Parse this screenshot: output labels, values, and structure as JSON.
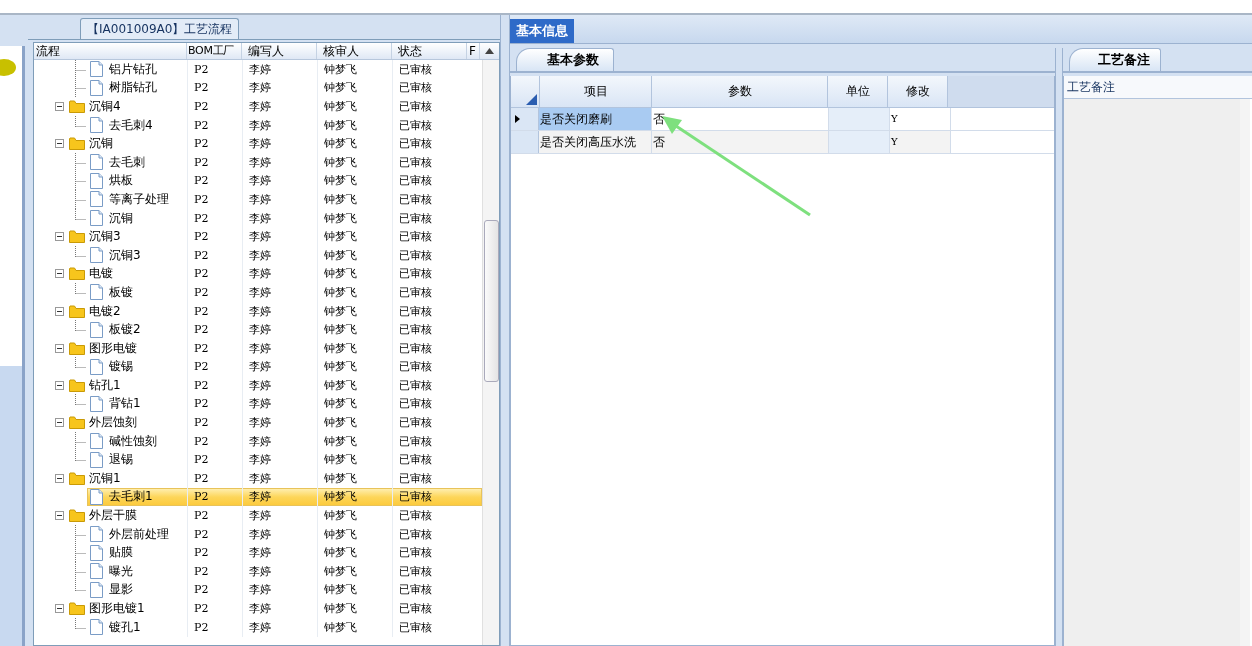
{
  "left_panel": {
    "title": "【IA001009A0】工艺流程",
    "columns": [
      "流程",
      "BOM工厂",
      "编写人",
      "核审人",
      "状态",
      "F"
    ],
    "tree": [
      {
        "kind": "file",
        "name": "铝片钻孔",
        "bom": "P2",
        "writer": "李婷",
        "reviewer": "钟梦飞",
        "status": "已审核",
        "selected": false
      },
      {
        "kind": "file",
        "name": "树脂钻孔",
        "bom": "P2",
        "writer": "李婷",
        "reviewer": "钟梦飞",
        "status": "已审核",
        "selected": false
      },
      {
        "kind": "folder",
        "name": "沉铜4",
        "bom": "P2",
        "writer": "李婷",
        "reviewer": "钟梦飞",
        "status": "已审核",
        "selected": false,
        "expanded": true,
        "children": [
          {
            "kind": "file",
            "name": "去毛刺4",
            "bom": "P2",
            "writer": "李婷",
            "reviewer": "钟梦飞",
            "status": "已审核",
            "selected": false
          }
        ]
      },
      {
        "kind": "folder",
        "name": "沉铜",
        "bom": "P2",
        "writer": "李婷",
        "reviewer": "钟梦飞",
        "status": "已审核",
        "selected": false,
        "expanded": true,
        "children": [
          {
            "kind": "file",
            "name": "去毛刺",
            "bom": "P2",
            "writer": "李婷",
            "reviewer": "钟梦飞",
            "status": "已审核",
            "selected": false
          },
          {
            "kind": "file",
            "name": "烘板",
            "bom": "P2",
            "writer": "李婷",
            "reviewer": "钟梦飞",
            "status": "已审核",
            "selected": false
          },
          {
            "kind": "file",
            "name": "等离子处理",
            "bom": "P2",
            "writer": "李婷",
            "reviewer": "钟梦飞",
            "status": "已审核",
            "selected": false
          },
          {
            "kind": "file",
            "name": "沉铜",
            "bom": "P2",
            "writer": "李婷",
            "reviewer": "钟梦飞",
            "status": "已审核",
            "selected": false
          }
        ]
      },
      {
        "kind": "folder",
        "name": "沉铜3",
        "bom": "P2",
        "writer": "李婷",
        "reviewer": "钟梦飞",
        "status": "已审核",
        "selected": false,
        "expanded": true,
        "children": [
          {
            "kind": "file",
            "name": "沉铜3",
            "bom": "P2",
            "writer": "李婷",
            "reviewer": "钟梦飞",
            "status": "已审核",
            "selected": false
          }
        ]
      },
      {
        "kind": "folder",
        "name": "电镀",
        "bom": "P2",
        "writer": "李婷",
        "reviewer": "钟梦飞",
        "status": "已审核",
        "selected": false,
        "expanded": true,
        "children": [
          {
            "kind": "file",
            "name": "板镀",
            "bom": "P2",
            "writer": "李婷",
            "reviewer": "钟梦飞",
            "status": "已审核",
            "selected": false
          }
        ]
      },
      {
        "kind": "folder",
        "name": "电镀2",
        "bom": "P2",
        "writer": "李婷",
        "reviewer": "钟梦飞",
        "status": "已审核",
        "selected": false,
        "expanded": true,
        "children": [
          {
            "kind": "file",
            "name": "板镀2",
            "bom": "P2",
            "writer": "李婷",
            "reviewer": "钟梦飞",
            "status": "已审核",
            "selected": false
          }
        ]
      },
      {
        "kind": "folder",
        "name": "图形电镀",
        "bom": "P2",
        "writer": "李婷",
        "reviewer": "钟梦飞",
        "status": "已审核",
        "selected": false,
        "expanded": true,
        "children": [
          {
            "kind": "file",
            "name": "镀锡",
            "bom": "P2",
            "writer": "李婷",
            "reviewer": "钟梦飞",
            "status": "已审核",
            "selected": false
          }
        ]
      },
      {
        "kind": "folder",
        "name": "钻孔1",
        "bom": "P2",
        "writer": "李婷",
        "reviewer": "钟梦飞",
        "status": "已审核",
        "selected": false,
        "expanded": true,
        "children": [
          {
            "kind": "file",
            "name": "背钻1",
            "bom": "P2",
            "writer": "李婷",
            "reviewer": "钟梦飞",
            "status": "已审核",
            "selected": false
          }
        ]
      },
      {
        "kind": "folder",
        "name": "外层蚀刻",
        "bom": "P2",
        "writer": "李婷",
        "reviewer": "钟梦飞",
        "status": "已审核",
        "selected": false,
        "expanded": true,
        "children": [
          {
            "kind": "file",
            "name": "碱性蚀刻",
            "bom": "P2",
            "writer": "李婷",
            "reviewer": "钟梦飞",
            "status": "已审核",
            "selected": false
          },
          {
            "kind": "file",
            "name": "退锡",
            "bom": "P2",
            "writer": "李婷",
            "reviewer": "钟梦飞",
            "status": "已审核",
            "selected": false
          }
        ]
      },
      {
        "kind": "folder",
        "name": "沉铜1",
        "bom": "P2",
        "writer": "李婷",
        "reviewer": "钟梦飞",
        "status": "已审核",
        "selected": false,
        "expanded": true,
        "children": [
          {
            "kind": "file",
            "name": "去毛刺1",
            "bom": "P2",
            "writer": "李婷",
            "reviewer": "钟梦飞",
            "status": "已审核",
            "selected": true
          }
        ]
      },
      {
        "kind": "folder",
        "name": "外层干膜",
        "bom": "P2",
        "writer": "李婷",
        "reviewer": "钟梦飞",
        "status": "已审核",
        "selected": false,
        "expanded": true,
        "children": [
          {
            "kind": "file",
            "name": "外层前处理",
            "bom": "P2",
            "writer": "李婷",
            "reviewer": "钟梦飞",
            "status": "已审核",
            "selected": false
          },
          {
            "kind": "file",
            "name": "贴膜",
            "bom": "P2",
            "writer": "李婷",
            "reviewer": "钟梦飞",
            "status": "已审核",
            "selected": false
          },
          {
            "kind": "file",
            "name": "曝光",
            "bom": "P2",
            "writer": "李婷",
            "reviewer": "钟梦飞",
            "status": "已审核",
            "selected": false
          },
          {
            "kind": "file",
            "name": "显影",
            "bom": "P2",
            "writer": "李婷",
            "reviewer": "钟梦飞",
            "status": "已审核",
            "selected": false
          }
        ]
      },
      {
        "kind": "folder",
        "name": "图形电镀1",
        "bom": "P2",
        "writer": "李婷",
        "reviewer": "钟梦飞",
        "status": "已审核",
        "selected": false,
        "expanded": true,
        "children": [
          {
            "kind": "file",
            "name": "镀孔1",
            "bom": "P2",
            "writer": "李婷",
            "reviewer": "钟梦飞",
            "status": "已审核",
            "selected": false
          }
        ]
      }
    ]
  },
  "right_tabs": [
    {
      "label": "基本信息",
      "selected": true
    }
  ],
  "params": {
    "tab": "基本参数",
    "columns": [
      "项目",
      "参数",
      "单位",
      "修改"
    ],
    "rows": [
      {
        "item": "是否关闭磨刷",
        "value": "否",
        "unit": "",
        "modify": "Y",
        "selected": true
      },
      {
        "item": "是否关闭高压水洗",
        "value": "否",
        "unit": "",
        "modify": "Y",
        "selected": false
      }
    ]
  },
  "notes": {
    "tab": "工艺备注",
    "label": "工艺备注"
  }
}
